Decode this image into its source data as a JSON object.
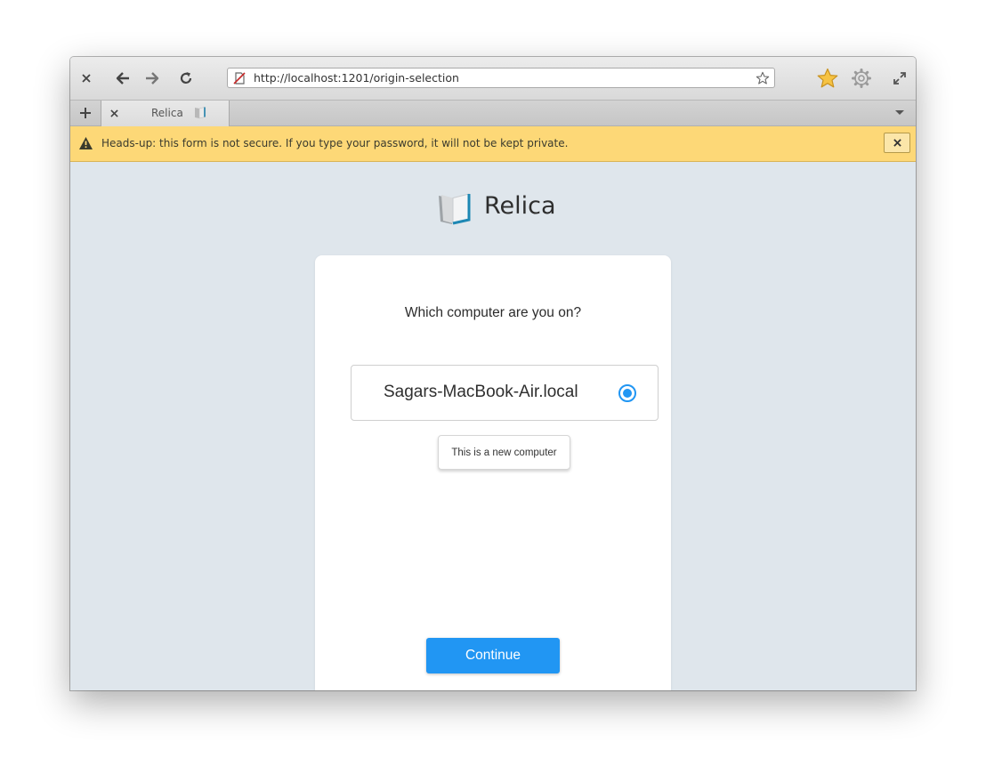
{
  "browser": {
    "url": "http://localhost:1201/origin-selection",
    "tab_title": "Relica",
    "nav_icons": [
      "close-icon",
      "back-arrow-icon",
      "forward-arrow-icon",
      "reload-icon"
    ],
    "right_icons": [
      "bookmark-star-icon",
      "settings-gear-icon",
      "fullscreen-icon"
    ]
  },
  "infobar": {
    "message": "Heads-up: this form is not secure. If you type your password, it will not be kept private."
  },
  "app": {
    "name": "Relica",
    "question": "Which computer are you on?",
    "computers": [
      {
        "label": "Sagars-MacBook-Air.local",
        "selected": true
      }
    ],
    "new_computer_label": "This is a new computer",
    "continue_label": "Continue",
    "accent_color": "#2196f3"
  }
}
